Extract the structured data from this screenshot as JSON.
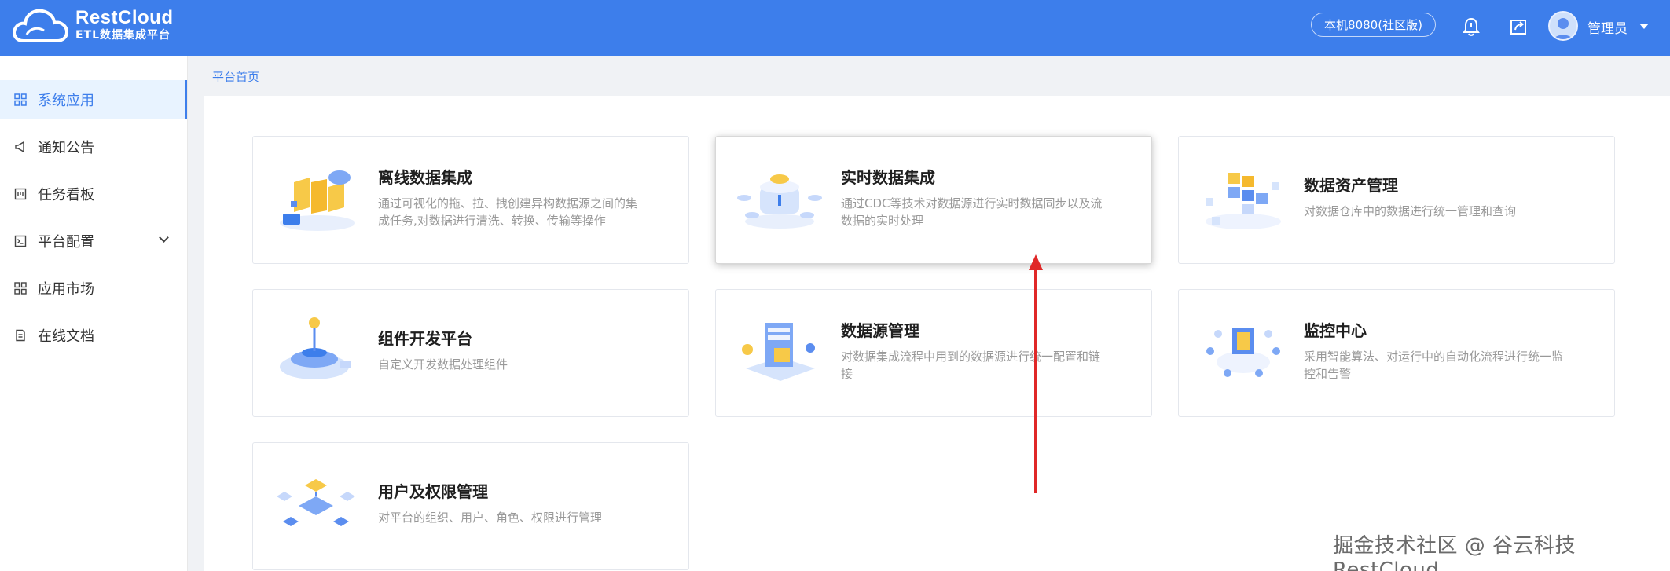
{
  "header": {
    "logo_title": "RestCloud",
    "logo_subtitle": "ETL数据集成平台",
    "env_badge": "本机8080(社区版)",
    "user_name": "管理员",
    "icons": [
      "bell-icon",
      "share-icon",
      "user-avatar",
      "caret-down-icon"
    ]
  },
  "sidebar": {
    "items": [
      {
        "label": "系统应用",
        "icon": "grid-icon",
        "active": true
      },
      {
        "label": "通知公告",
        "icon": "megaphone-icon"
      },
      {
        "label": "任务看板",
        "icon": "board-icon"
      },
      {
        "label": "平台配置",
        "icon": "terminal-icon",
        "has_submenu": true
      },
      {
        "label": "应用市场",
        "icon": "grid-icon"
      },
      {
        "label": "在线文档",
        "icon": "document-icon"
      }
    ]
  },
  "breadcrumb": "平台首页",
  "cards": [
    {
      "title": "离线数据集成",
      "desc": "通过可视化的拖、拉、拽创建异构数据源之间的集成任务,对数据进行清洗、转换、传输等操作"
    },
    {
      "title": "实时数据集成",
      "desc": "通过CDC等技术对数据源进行实时数据同步以及流数据的实时处理"
    },
    {
      "title": "数据资产管理",
      "desc": "对数据仓库中的数据进行统一管理和查询"
    },
    {
      "title": "组件开发平台",
      "desc": "自定义开发数据处理组件"
    },
    {
      "title": "数据源管理",
      "desc": "对数据集成流程中用到的数据源进行统一配置和链接"
    },
    {
      "title": "监控中心",
      "desc": "采用智能算法、对运行中的自动化流程进行统一监控和告警"
    },
    {
      "title": "用户及权限管理",
      "desc": "对平台的组织、用户、角色、权限进行管理"
    }
  ],
  "watermark": "掘金技术社区 @ 谷云科技RestCloud",
  "colors": {
    "primary": "#3d7eeb",
    "annotation_arrow": "#e02828"
  }
}
